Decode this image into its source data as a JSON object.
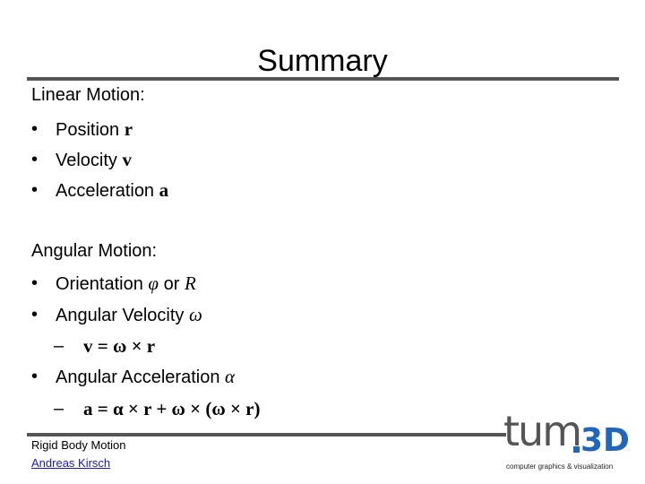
{
  "slide": {
    "title": "Summary",
    "linear": {
      "heading": "Linear Motion:",
      "items": [
        {
          "label": "Position",
          "symbol": "r"
        },
        {
          "label": "Velocity",
          "symbol": "v"
        },
        {
          "label": "Acceleration",
          "symbol": "a"
        }
      ]
    },
    "angular": {
      "heading": "Angular Motion:",
      "orientation": {
        "label": "Orientation",
        "symbol1": "φ",
        "connector": "or",
        "symbol2": "R"
      },
      "velocity": {
        "label": "Angular Velocity",
        "symbol": "ω",
        "equation": "v = ω × r"
      },
      "acceleration": {
        "label": "Angular Acceleration",
        "symbol": "α",
        "equation": "a = α × r + ω × (ω × r)"
      }
    },
    "bullet_glyph": "•",
    "dash_glyph": "–"
  },
  "footer": {
    "title": "Rigid Body Motion",
    "author": "Andreas Kirsch"
  },
  "logo": {
    "wordmark": "tum",
    "suffix": "3D",
    "tagline": "computer graphics & visualization",
    "colors": {
      "gray": "#555555",
      "blue": "#2266bb"
    }
  }
}
